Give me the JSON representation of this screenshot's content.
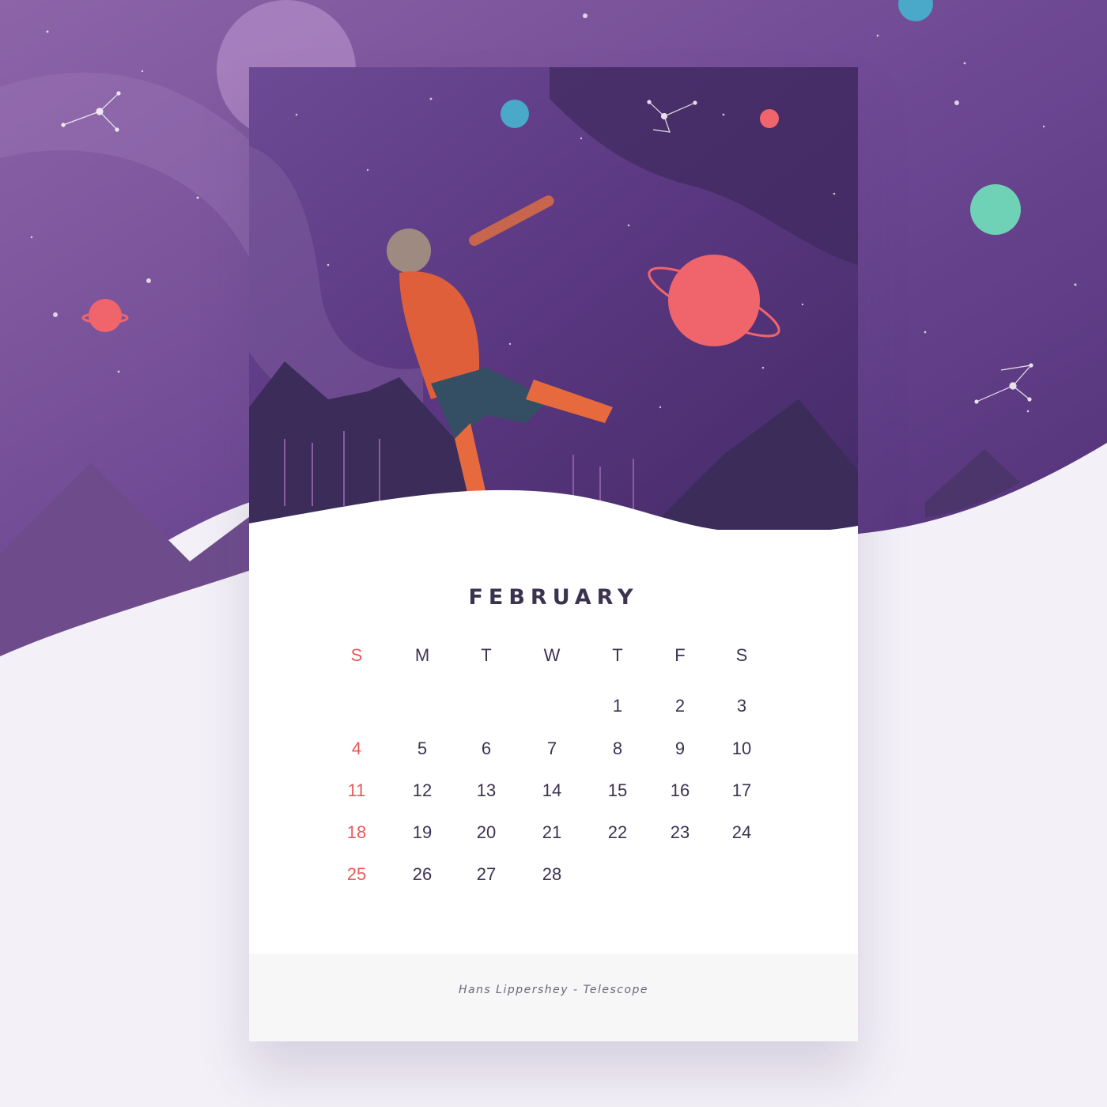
{
  "calendar": {
    "month": "FEBRUARY",
    "weekdays": [
      "S",
      "M",
      "T",
      "W",
      "T",
      "F",
      "S"
    ],
    "weeks": [
      [
        "",
        "",
        "",
        "",
        "1",
        "2",
        "3"
      ],
      [
        "4",
        "5",
        "6",
        "7",
        "8",
        "9",
        "10"
      ],
      [
        "11",
        "12",
        "13",
        "14",
        "15",
        "16",
        "17"
      ],
      [
        "18",
        "19",
        "20",
        "21",
        "22",
        "23",
        "24"
      ],
      [
        "25",
        "26",
        "27",
        "28",
        "",
        "",
        ""
      ]
    ],
    "credit": "Hans Lippershey  - Telescope"
  },
  "colors": {
    "sky": "#5a3780",
    "sunday": "#e65a5a",
    "text": "#3b3350",
    "planet_red": "#f0656b",
    "planet_teal": "#6fd1b5",
    "planet_blue": "#4aa8c8",
    "mountains": "#3c2c59"
  },
  "illustration": {
    "icons": [
      "planet-icon",
      "constellation-icon",
      "pine-tree-icon",
      "mountain-icon",
      "astronomer-with-telescope-icon"
    ]
  }
}
